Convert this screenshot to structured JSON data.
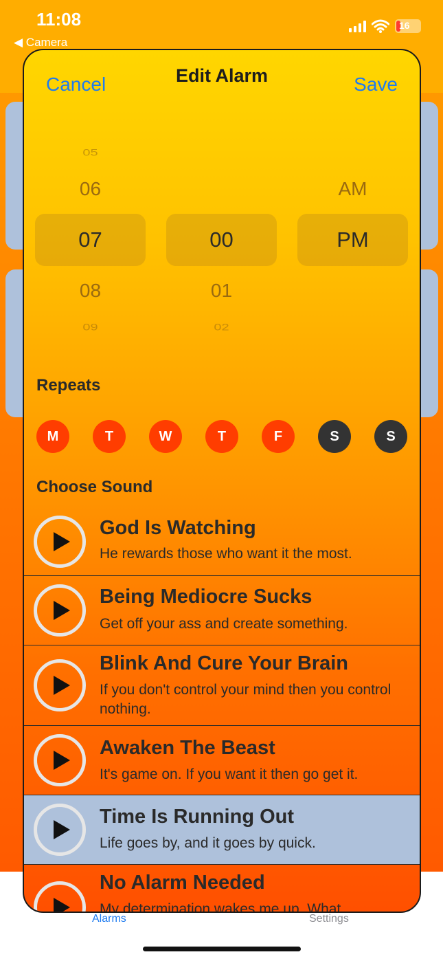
{
  "status_bar": {
    "time": "11:08",
    "back_label": "◀ Camera",
    "battery": "16"
  },
  "nav": {
    "cancel": "Cancel",
    "title": "Edit Alarm",
    "save": "Save"
  },
  "picker": {
    "hours": [
      "05",
      "06",
      "07",
      "08",
      "09"
    ],
    "minutes": [
      "00",
      "01",
      "02"
    ],
    "periods": [
      "AM",
      "PM"
    ],
    "selected": {
      "hour": "07",
      "minute": "00",
      "period": "PM"
    }
  },
  "repeats": {
    "label": "Repeats",
    "days": [
      {
        "label": "M",
        "active": true
      },
      {
        "label": "T",
        "active": true
      },
      {
        "label": "W",
        "active": true
      },
      {
        "label": "T",
        "active": true
      },
      {
        "label": "F",
        "active": true
      },
      {
        "label": "S",
        "active": false
      },
      {
        "label": "S",
        "active": false
      }
    ]
  },
  "sound": {
    "label": "Choose Sound",
    "items": [
      {
        "title": "God Is Watching",
        "desc": "He rewards those who want it the most.",
        "selected": false
      },
      {
        "title": "Being Mediocre Sucks",
        "desc": "Get off your ass and create something.",
        "selected": false
      },
      {
        "title": "Blink And Cure Your Brain",
        "desc": "If you don't control your mind then you control nothing.",
        "selected": false
      },
      {
        "title": "Awaken The Beast",
        "desc": "It's game on. If you want it then go get it.",
        "selected": false
      },
      {
        "title": "Time Is Running Out",
        "desc": "Life goes by, and it goes by quick.",
        "selected": true
      },
      {
        "title": "No Alarm Needed",
        "desc": "My determination wakes me up. What",
        "selected": false
      }
    ]
  },
  "tabs": {
    "alarms": "Alarms",
    "settings": "Settings"
  },
  "colors": {
    "accent": "#1e7bf0",
    "day_active": "#ff3d00",
    "day_inactive": "#333333",
    "selected_row": "#aec1db"
  }
}
